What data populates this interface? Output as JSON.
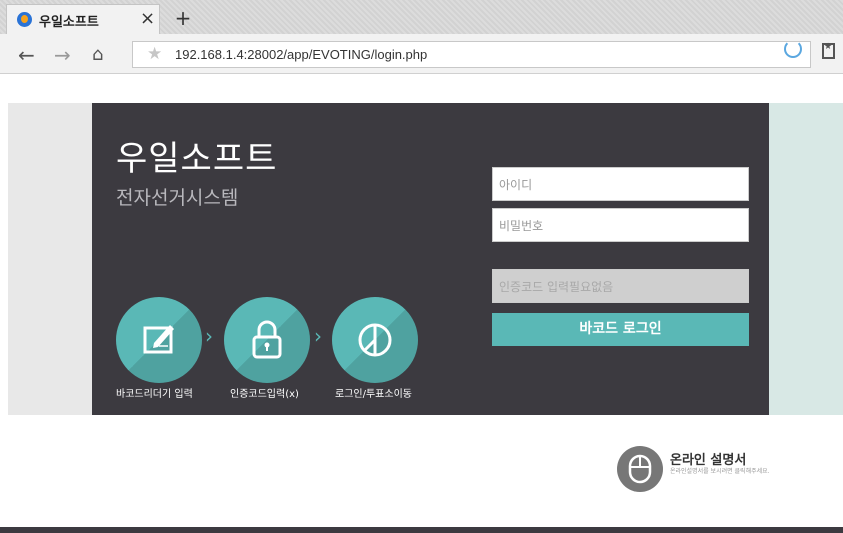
{
  "browser": {
    "tab_title": "우일소프트",
    "tab_close": "×",
    "new_tab": "+",
    "url": "192.168.1.4:28002/app/EVOTING/login.php",
    "icons": [
      "back-icon",
      "forward-icon",
      "home-icon",
      "star-icon",
      "reload-icon",
      "bookmark-icon"
    ]
  },
  "brand": {
    "title": "우일소프트",
    "subtitle": "전자선거시스템"
  },
  "steps": [
    {
      "label": "바코드리더기 입력",
      "icon": "edit-icon"
    },
    {
      "label": "인증코드입력(x)",
      "icon": "lock-icon"
    },
    {
      "label": "로그인/투표소이동",
      "icon": "pie-icon"
    }
  ],
  "login": {
    "id_placeholder": "아이디",
    "pw_placeholder": "비밀번호",
    "code_placeholder": "인증코드 입력필요없음",
    "button_label": "바코드 로그인"
  },
  "manual": {
    "title": "온라인 설명서",
    "description": "온라인설명서를 보시려면 클릭해주세요."
  },
  "colors": {
    "panel": "#3c3a40",
    "accent": "#5ab8b6"
  }
}
